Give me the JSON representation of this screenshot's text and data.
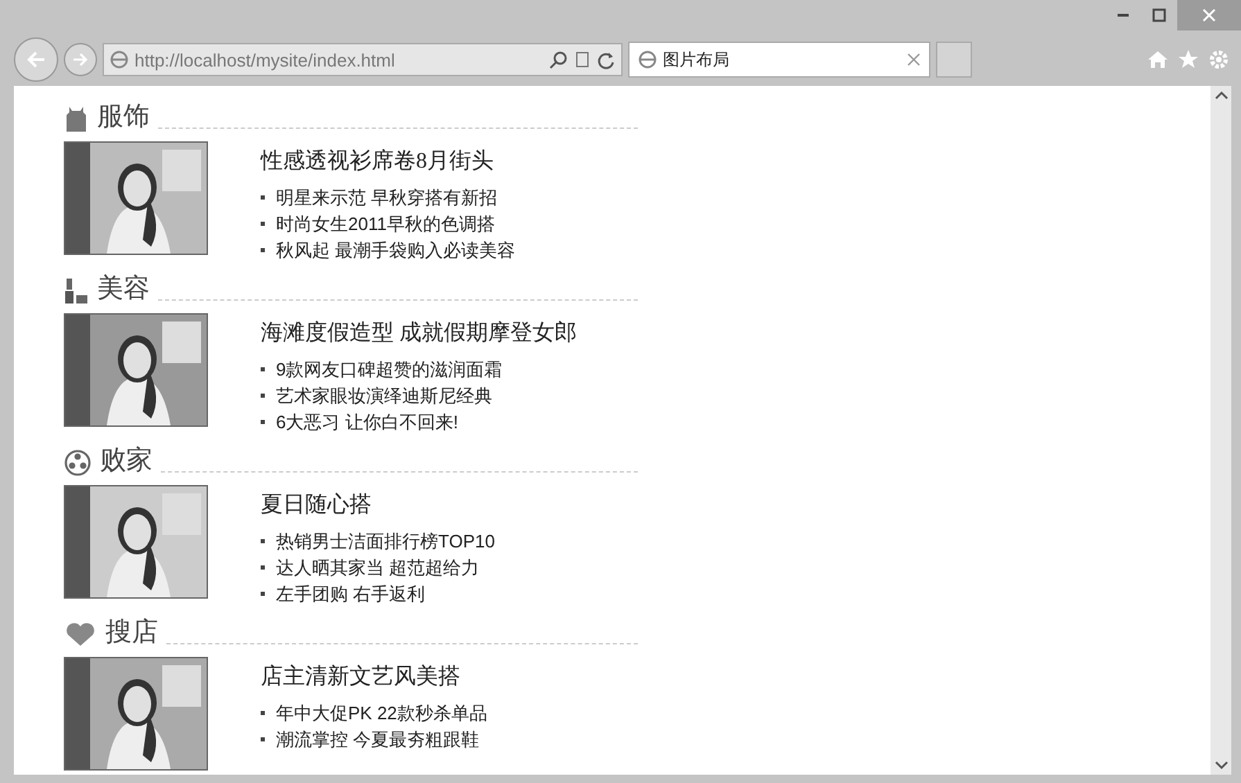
{
  "browser": {
    "address": "http://localhost/mysite/index.html",
    "tab": {
      "title": "图片布局",
      "selected": true
    }
  },
  "sections": [
    {
      "kind": "dress",
      "heading": "服饰",
      "title": "性感透视衫席卷8月街头",
      "items": [
        "明星来示范 早秋穿搭有新招",
        "时尚女生2011早秋的色调搭",
        "秋风起 最潮手袋购入必读美容"
      ]
    },
    {
      "kind": "lipstick",
      "heading": "美容",
      "title": "海滩度假造型 成就假期摩登女郎",
      "items": [
        "9款网友口碑超赞的滋润面霜",
        "艺术家眼妆演绎迪斯尼经典",
        "6大恶习 让你白不回来!"
      ]
    },
    {
      "kind": "reel",
      "heading": "败家",
      "title": "夏日随心搭",
      "items": [
        "热销男士洁面排行榜TOP10",
        "达人晒其家当 超范超给力",
        "左手团购 右手返利"
      ]
    },
    {
      "kind": "heart",
      "heading": "搜店",
      "title": "店主清新文艺风美搭",
      "items": [
        "年中大促PK 22款秒杀单品",
        "潮流掌控 今夏最夯粗跟鞋"
      ]
    }
  ]
}
